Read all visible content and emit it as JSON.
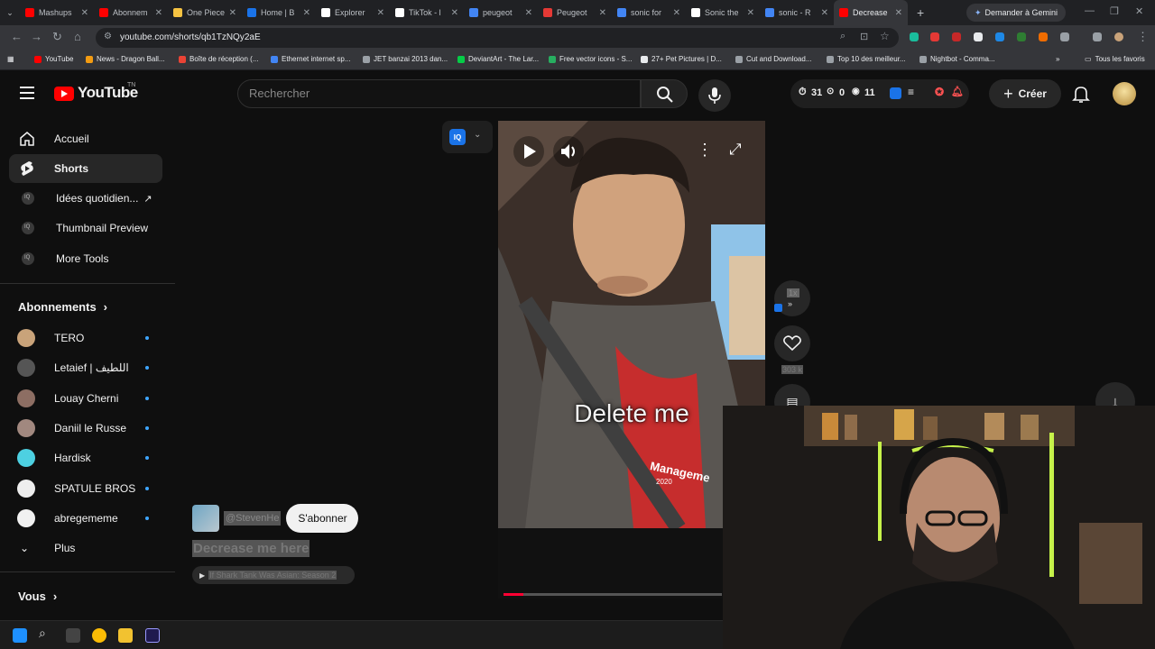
{
  "browser": {
    "tabs": [
      {
        "label": "Mashups",
        "color": "#ff0000"
      },
      {
        "label": "Abonnem",
        "color": "#ff0000"
      },
      {
        "label": "One Piece",
        "color": "#f6c342"
      },
      {
        "label": "Home | B",
        "color": "#1a73e8"
      },
      {
        "label": "Explorer",
        "color": "#ffffff"
      },
      {
        "label": "TikTok - l",
        "color": "#ffffff"
      },
      {
        "label": "peugeot",
        "color": "#4285f4"
      },
      {
        "label": "Peugeot",
        "color": "#e53935"
      },
      {
        "label": "sonic for",
        "color": "#4285f4"
      },
      {
        "label": "Sonic the",
        "color": "#ffffff"
      },
      {
        "label": "sonic - R",
        "color": "#4285f4"
      },
      {
        "label": "Decrease",
        "color": "#ff0000",
        "active": true
      }
    ],
    "new_tab_label": "+",
    "gemini_label": "Demander à Gemini",
    "url": "youtube.com/shorts/qb1TzNQy2aE",
    "bookmarks": [
      {
        "label": "YouTube",
        "color": "#ff0000"
      },
      {
        "label": "News - Dragon Ball...",
        "color": "#f39c12"
      },
      {
        "label": "Boîte de réception (...",
        "color": "#ea4335"
      },
      {
        "label": "Ethernet internet sp...",
        "color": "#4285f4"
      },
      {
        "label": "JET banzai 2013 dan...",
        "color": "#9aa0a6"
      },
      {
        "label": "DeviantArt - The Lar...",
        "color": "#05cc47"
      },
      {
        "label": "Free vector icons - S...",
        "color": "#27ae60"
      },
      {
        "label": "27+ Pet Pictures | D...",
        "color": "#e8eaed"
      },
      {
        "label": "Cut and Download...",
        "color": "#9aa0a6"
      },
      {
        "label": "Top 10 des meilleur...",
        "color": "#9aa0a6"
      },
      {
        "label": "Nightbot - Comma...",
        "color": "#9aa0a6"
      }
    ],
    "all_bookmarks_label": "Tous les favoris"
  },
  "youtube": {
    "logo_text": "YouTube",
    "country_code": "TN",
    "search_placeholder": "Rechercher",
    "stats": {
      "watch": "31",
      "zero": "0",
      "views": "11"
    },
    "create_label": "Créer"
  },
  "sidebar": {
    "items": [
      {
        "label": "Accueil"
      },
      {
        "label": "Shorts"
      },
      {
        "label": "Idées quotidien..."
      },
      {
        "label": "Thumbnail Preview"
      },
      {
        "label": "More Tools"
      }
    ],
    "subscriptions_heading": "Abonnements",
    "subscriptions": [
      {
        "label": "TERO",
        "color": "#c9a37a"
      },
      {
        "label": "Letaief | اللطيف",
        "color": "#555555"
      },
      {
        "label": "Louay Cherni",
        "color": "#8d6e63"
      },
      {
        "label": "Daniil le Russe",
        "color": "#a1887f"
      },
      {
        "label": "Hardisk",
        "color": "#4dd0e1"
      },
      {
        "label": "SPATULE BROS",
        "color": "#eeeeee"
      },
      {
        "label": "abregememe",
        "color": "#f1f1f1"
      }
    ],
    "more_label": "Plus",
    "you_heading": "Vous"
  },
  "short": {
    "caption": "Delete me",
    "shirt_text": "Manageme",
    "shirt_year": "2020",
    "channel_handle": "@StevenHe",
    "subscribe_label": "S'abonner",
    "title": "Decrease me here",
    "related_label": "If Shark Tank Was Asian: Season 2",
    "speed_label": "1x",
    "like_count": "303 k",
    "progress": 0.09
  }
}
